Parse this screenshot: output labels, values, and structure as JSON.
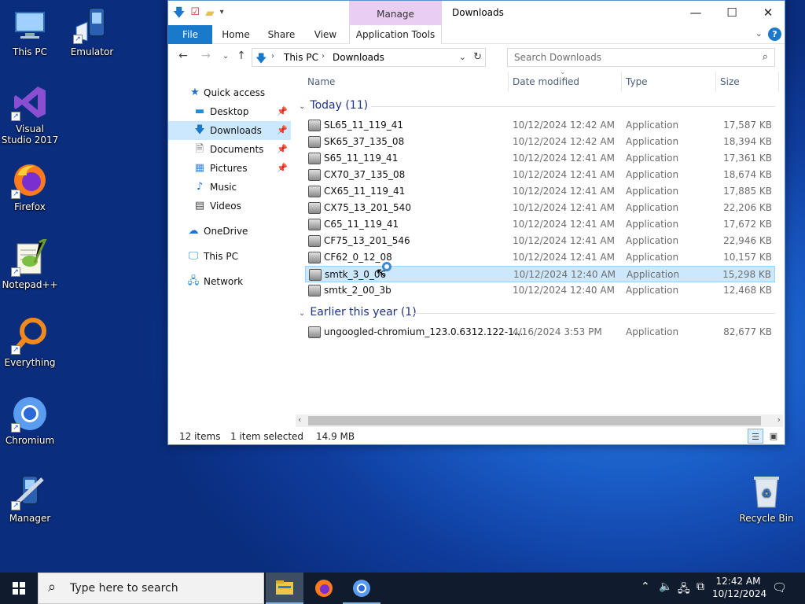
{
  "desktop_icons": [
    {
      "label": "This PC",
      "icon": "this-pc-icon"
    },
    {
      "label": "Emulator",
      "icon": "emulator-icon"
    },
    {
      "label": "Visual Studio 2017",
      "icon": "visual-studio-icon"
    },
    {
      "label": "Firefox",
      "icon": "firefox-icon"
    },
    {
      "label": "Notepad++",
      "icon": "notepadpp-icon"
    },
    {
      "label": "Everything",
      "icon": "everything-icon"
    },
    {
      "label": "Chromium",
      "icon": "chromium-icon"
    },
    {
      "label": "Manager",
      "icon": "manager-icon"
    },
    {
      "label": "Recycle Bin",
      "icon": "recycle-bin-icon"
    }
  ],
  "window": {
    "title": "Downloads",
    "manage_label": "Manage",
    "ribbon_tabs": [
      "File",
      "Home",
      "Share",
      "View",
      "Application Tools"
    ],
    "address": {
      "segments": [
        "This PC",
        "Downloads"
      ]
    },
    "search_placeholder": "Search Downloads",
    "columns": [
      "Name",
      "Date modified",
      "Type",
      "Size"
    ],
    "sidebar": {
      "items": [
        {
          "label": "Quick access",
          "icon": "star-icon"
        },
        {
          "label": "Desktop",
          "icon": "desktop-folder-icon",
          "pinned": true
        },
        {
          "label": "Downloads",
          "icon": "download-arrow-icon",
          "pinned": true,
          "selected": true
        },
        {
          "label": "Documents",
          "icon": "documents-icon",
          "pinned": true
        },
        {
          "label": "Pictures",
          "icon": "pictures-icon",
          "pinned": true
        },
        {
          "label": "Music",
          "icon": "music-icon"
        },
        {
          "label": "Videos",
          "icon": "videos-icon"
        },
        {
          "label": "OneDrive",
          "icon": "onedrive-icon"
        },
        {
          "label": "This PC",
          "icon": "this-pc-icon"
        },
        {
          "label": "Network",
          "icon": "network-icon"
        }
      ]
    },
    "groups": [
      {
        "title": "Today (11)",
        "files": [
          {
            "name": "SL65_11_119_41",
            "date": "10/12/2024 12:42 AM",
            "type": "Application",
            "size": "17,587 KB"
          },
          {
            "name": "SK65_37_135_08",
            "date": "10/12/2024 12:42 AM",
            "type": "Application",
            "size": "18,394 KB"
          },
          {
            "name": "S65_11_119_41",
            "date": "10/12/2024 12:41 AM",
            "type": "Application",
            "size": "17,361 KB"
          },
          {
            "name": "CX70_37_135_08",
            "date": "10/12/2024 12:41 AM",
            "type": "Application",
            "size": "18,674 KB"
          },
          {
            "name": "CX65_11_119_41",
            "date": "10/12/2024 12:41 AM",
            "type": "Application",
            "size": "17,885 KB"
          },
          {
            "name": "CX75_13_201_540",
            "date": "10/12/2024 12:41 AM",
            "type": "Application",
            "size": "22,206 KB"
          },
          {
            "name": "C65_11_119_41",
            "date": "10/12/2024 12:41 AM",
            "type": "Application",
            "size": "17,672 KB"
          },
          {
            "name": "CF75_13_201_546",
            "date": "10/12/2024 12:41 AM",
            "type": "Application",
            "size": "22,946 KB"
          },
          {
            "name": "CF62_0_12_08",
            "date": "10/12/2024 12:41 AM",
            "type": "Application",
            "size": "10,157 KB"
          },
          {
            "name": "smtk_3_0_06",
            "date": "10/12/2024 12:40 AM",
            "type": "Application",
            "size": "15,298 KB",
            "selected": true
          },
          {
            "name": "smtk_2_00_3b",
            "date": "10/12/2024 12:40 AM",
            "type": "Application",
            "size": "12,468 KB"
          }
        ]
      },
      {
        "title": "Earlier this year (1)",
        "files": [
          {
            "name": "ungoogled-chromium_123.0.6312.122-1....",
            "date": "4/16/2024 3:53 PM",
            "type": "Application",
            "size": "82,677 KB"
          }
        ]
      }
    ],
    "status": {
      "items": "12 items",
      "selected": "1 item selected",
      "size": "14.9 MB"
    }
  },
  "taskbar": {
    "search_placeholder": "Type here to search",
    "apps": [
      "file-explorer-icon",
      "firefox-icon",
      "chromium-icon"
    ],
    "clock_time": "12:42 AM",
    "clock_date": "10/12/2024"
  },
  "colors": {
    "accent": "#1979ca",
    "selection": "#cce8ff",
    "manage_band": "#eacdf2",
    "taskbar": "#101c2e"
  }
}
